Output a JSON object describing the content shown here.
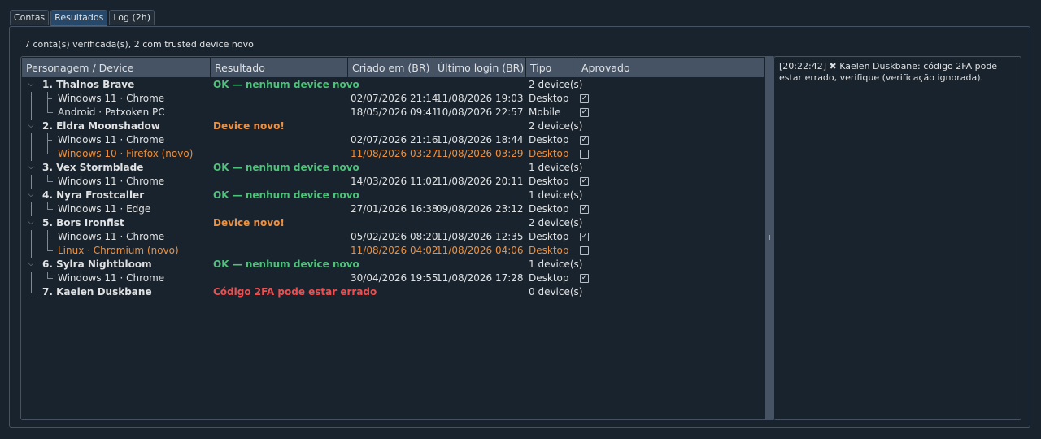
{
  "tabs": [
    {
      "label": "Contas",
      "active": false
    },
    {
      "label": "Resultados",
      "active": true
    },
    {
      "label": "Log (2h)",
      "active": false
    }
  ],
  "summary": "7 conta(s) verificada(s), 2 com trusted device novo",
  "columns": [
    "Personagem / Device",
    "Resultado",
    "Criado em (BR)",
    "Último login (BR)",
    "Tipo",
    "Aprovado"
  ],
  "accounts": [
    {
      "name": "1. Thalnos Brave",
      "result": "OK — nenhum device novo",
      "status": "ok",
      "count": "2 device(s)",
      "devices": [
        {
          "name": "Windows 11 · Chrome",
          "created": "02/07/2026 21:14",
          "last": "11/08/2026 19:03",
          "type": "Desktop",
          "approved": true,
          "new": false
        },
        {
          "name": "Android · Patxoken PC",
          "created": "18/05/2026 09:41",
          "last": "10/08/2026 22:57",
          "type": "Mobile",
          "approved": true,
          "new": false
        }
      ]
    },
    {
      "name": "2. Eldra Moonshadow",
      "result": "Device novo!",
      "status": "warn",
      "count": "2 device(s)",
      "devices": [
        {
          "name": "Windows 11 · Chrome",
          "created": "02/07/2026 21:16",
          "last": "11/08/2026 18:44",
          "type": "Desktop",
          "approved": true,
          "new": false
        },
        {
          "name": "Windows 10 · Firefox (novo)",
          "created": "11/08/2026 03:27",
          "last": "11/08/2026 03:29",
          "type": "Desktop",
          "approved": false,
          "new": true
        }
      ]
    },
    {
      "name": "3. Vex Stormblade",
      "result": "OK — nenhum device novo",
      "status": "ok",
      "count": "1 device(s)",
      "devices": [
        {
          "name": "Windows 11 · Chrome",
          "created": "14/03/2026 11:02",
          "last": "11/08/2026 20:11",
          "type": "Desktop",
          "approved": true,
          "new": false
        }
      ]
    },
    {
      "name": "4. Nyra Frostcaller",
      "result": "OK — nenhum device novo",
      "status": "ok",
      "count": "1 device(s)",
      "devices": [
        {
          "name": "Windows 11 · Edge",
          "created": "27/01/2026 16:38",
          "last": "09/08/2026 23:12",
          "type": "Desktop",
          "approved": true,
          "new": false
        }
      ]
    },
    {
      "name": "5. Bors Ironfist",
      "result": "Device novo!",
      "status": "warn",
      "count": "2 device(s)",
      "devices": [
        {
          "name": "Windows 11 · Chrome",
          "created": "05/02/2026 08:20",
          "last": "11/08/2026 12:35",
          "type": "Desktop",
          "approved": true,
          "new": false
        },
        {
          "name": "Linux · Chromium (novo)",
          "created": "11/08/2026 04:02",
          "last": "11/08/2026 04:06",
          "type": "Desktop",
          "approved": false,
          "new": true
        }
      ]
    },
    {
      "name": "6. Sylra Nightbloom",
      "result": "OK — nenhum device novo",
      "status": "ok",
      "count": "1 device(s)",
      "devices": [
        {
          "name": "Windows 11 · Chrome",
          "created": "30/04/2026 19:55",
          "last": "11/08/2026 17:28",
          "type": "Desktop",
          "approved": true,
          "new": false
        }
      ]
    },
    {
      "name": "7. Kaelen Duskbane",
      "result": "Código 2FA pode estar errado",
      "status": "err",
      "count": "0 device(s)",
      "devices": []
    }
  ],
  "log": {
    "time": "[20:22:42]",
    "icon": "✖",
    "message": "Kaelen Duskbane: código 2FA pode estar errado, verifique (verificação ignorada)."
  },
  "colors": {
    "ok": "#4ec27a",
    "warn": "#f0903c",
    "err": "#f04e4e",
    "accent": "#346792"
  }
}
